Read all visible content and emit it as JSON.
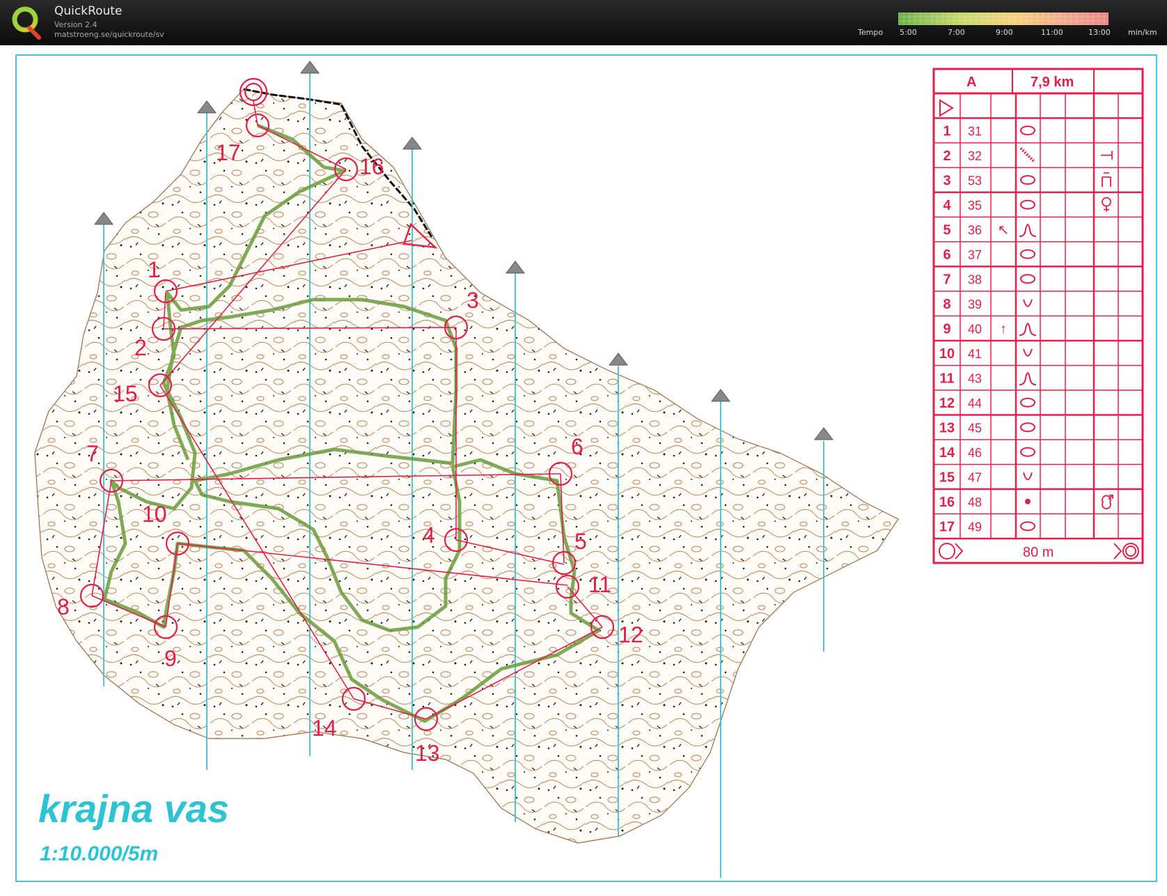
{
  "app": {
    "title": "QuickRoute",
    "version": "Version 2.4",
    "url": "matstroeng.se/quickroute/sv",
    "logo_letter": "Q"
  },
  "tempo": {
    "label": "Tempo",
    "ticks": [
      "5:00",
      "7:00",
      "9:00",
      "11:00",
      "13:00"
    ],
    "unit": "min/km",
    "colors": [
      "#7ab648",
      "#a9c95b",
      "#d4dd6a",
      "#f0c870",
      "#f0a080",
      "#e88080"
    ]
  },
  "map": {
    "name": "krajna vas",
    "scale": "1:10.000/5m",
    "course_color": "#e0204a",
    "north_line_color": "#3fbfcf",
    "controls": [
      {
        "label": "1"
      },
      {
        "label": "2"
      },
      {
        "label": "3"
      },
      {
        "label": "4"
      },
      {
        "label": "5"
      },
      {
        "label": "6"
      },
      {
        "label": "7"
      },
      {
        "label": "8"
      },
      {
        "label": "9"
      },
      {
        "label": "10"
      },
      {
        "label": "11"
      },
      {
        "label": "12"
      },
      {
        "label": "13"
      },
      {
        "label": "14"
      },
      {
        "label": "15"
      },
      {
        "label": "16"
      },
      {
        "label": "17"
      }
    ]
  },
  "description_sheet": {
    "class": "A",
    "length": "7,9 km",
    "rows": [
      {
        "num": "1",
        "code": "31",
        "dir": "",
        "symbol": "knoll-oval",
        "extra": ""
      },
      {
        "num": "2",
        "code": "32",
        "dir": "",
        "symbol": "ditch",
        "extra": "T"
      },
      {
        "num": "3",
        "code": "53",
        "dir": "",
        "symbol": "knoll-oval",
        "extra": "foot-of"
      },
      {
        "num": "4",
        "code": "35",
        "dir": "",
        "symbol": "knoll-oval",
        "extra": "female"
      },
      {
        "num": "5",
        "code": "36",
        "dir": "↖",
        "symbol": "spur",
        "extra": ""
      },
      {
        "num": "6",
        "code": "37",
        "dir": "",
        "symbol": "knoll-oval",
        "extra": ""
      },
      {
        "num": "7",
        "code": "38",
        "dir": "",
        "symbol": "knoll-oval",
        "extra": ""
      },
      {
        "num": "8",
        "code": "39",
        "dir": "",
        "symbol": "depression",
        "extra": ""
      },
      {
        "num": "9",
        "code": "40",
        "dir": "↑",
        "symbol": "spur",
        "extra": ""
      },
      {
        "num": "10",
        "code": "41",
        "dir": "",
        "symbol": "depression",
        "extra": ""
      },
      {
        "num": "11",
        "code": "43",
        "dir": "",
        "symbol": "spur",
        "extra": ""
      },
      {
        "num": "12",
        "code": "44",
        "dir": "",
        "symbol": "knoll-oval",
        "extra": ""
      },
      {
        "num": "13",
        "code": "45",
        "dir": "",
        "symbol": "knoll-oval",
        "extra": ""
      },
      {
        "num": "14",
        "code": "46",
        "dir": "",
        "symbol": "knoll-oval",
        "extra": ""
      },
      {
        "num": "15",
        "code": "47",
        "dir": "",
        "symbol": "depression",
        "extra": ""
      },
      {
        "num": "16",
        "code": "48",
        "dir": "",
        "symbol": "dot",
        "extra": "male"
      },
      {
        "num": "17",
        "code": "49",
        "dir": "",
        "symbol": "knoll-oval",
        "extra": ""
      }
    ],
    "finish_distance": "80 m"
  }
}
